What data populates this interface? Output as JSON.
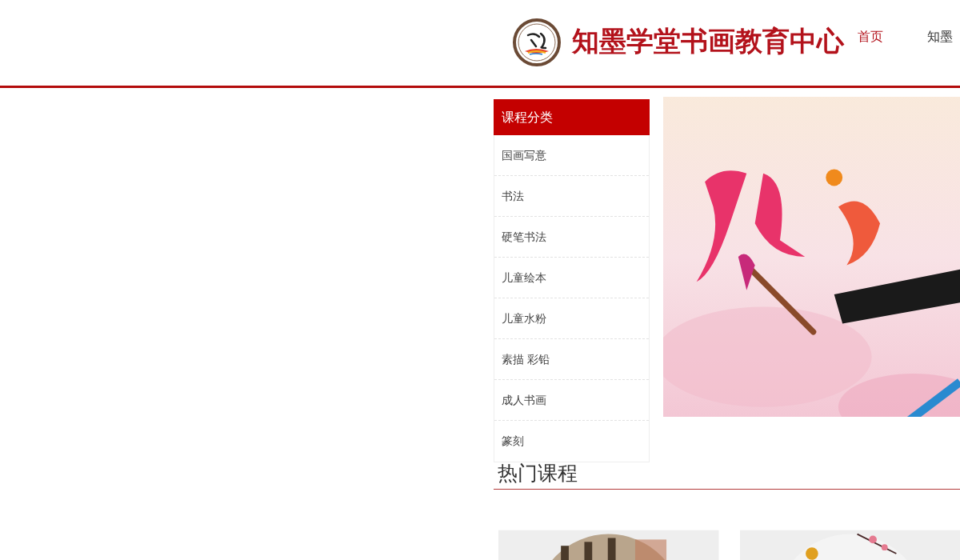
{
  "header": {
    "title": "知墨学堂书画教育中心",
    "nav": [
      {
        "label": "首页",
        "selected": true
      },
      {
        "label": "知墨",
        "selected": false
      }
    ]
  },
  "sidebar": {
    "title": "课程分类",
    "items": [
      "国画写意",
      "书法",
      "硬笔书法",
      "儿童绘本",
      "儿童水粉",
      "素描 彩铅",
      "成人书画",
      "篆刻"
    ]
  },
  "hot_courses": {
    "title": "热门课程"
  }
}
